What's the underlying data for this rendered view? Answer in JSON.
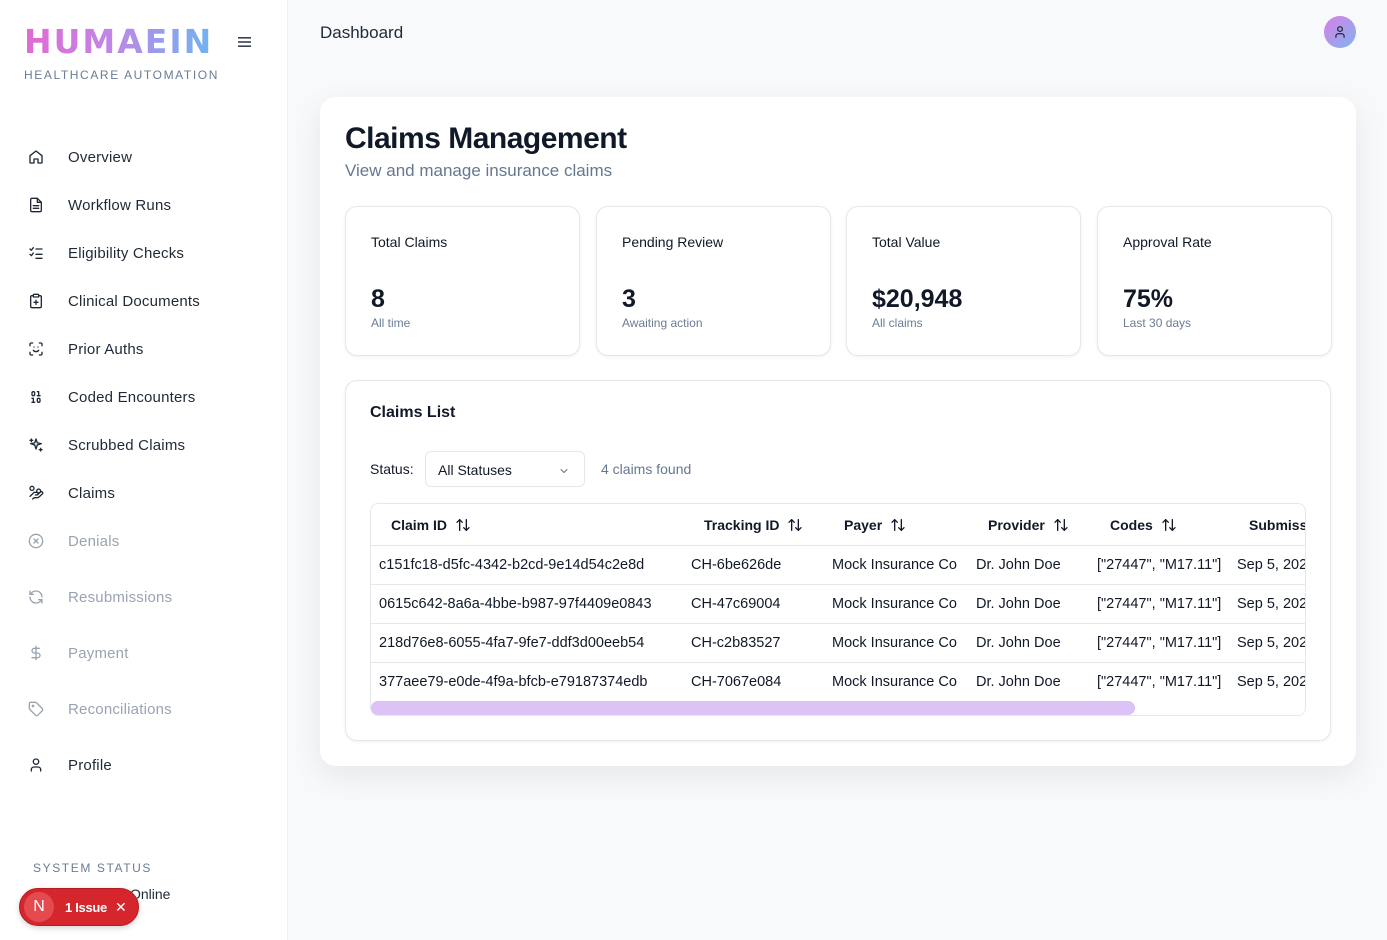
{
  "brand": {
    "name": "HUMAEIN",
    "tagline": "HEALTHCARE AUTOMATION"
  },
  "header": {
    "title": "Dashboard"
  },
  "sidebar": {
    "items": [
      {
        "label": "Overview",
        "icon": "home-icon"
      },
      {
        "label": "Workflow Runs",
        "icon": "file-text-icon"
      },
      {
        "label": "Eligibility Checks",
        "icon": "list-checks-icon"
      },
      {
        "label": "Clinical Documents",
        "icon": "clipboard-icon"
      },
      {
        "label": "Prior Auths",
        "icon": "scan-face-icon"
      },
      {
        "label": "Coded Encounters",
        "icon": "binary-icon"
      },
      {
        "label": "Scrubbed Claims",
        "icon": "sparkles-icon"
      },
      {
        "label": "Claims",
        "icon": "hand-coins-icon"
      },
      {
        "label": "Denials",
        "icon": "circle-x-icon"
      },
      {
        "label": "Resubmissions",
        "icon": "refresh-icon"
      },
      {
        "label": "Payment",
        "icon": "dollar-icon"
      },
      {
        "label": "Reconciliations",
        "icon": "tag-icon"
      },
      {
        "label": "Profile",
        "icon": "user-icon"
      }
    ],
    "system_status_label": "SYSTEM STATUS",
    "system_status_value": "Online",
    "issue_badge": {
      "initial": "N",
      "text": "1 Issue"
    }
  },
  "page": {
    "title": "Claims Management",
    "subtitle": "View and manage insurance claims"
  },
  "stats": [
    {
      "label": "Total Claims",
      "value": "8",
      "note": "All time"
    },
    {
      "label": "Pending Review",
      "value": "3",
      "note": "Awaiting action"
    },
    {
      "label": "Total Value",
      "value": "$20,948",
      "note": "All claims"
    },
    {
      "label": "Approval Rate",
      "value": "75%",
      "note": "Last 30 days"
    }
  ],
  "claims_list": {
    "title": "Claims List",
    "status_label": "Status:",
    "status_selected": "All Statuses",
    "count_text": "4 claims found",
    "columns": [
      "Claim ID",
      "Tracking ID",
      "Payer",
      "Provider",
      "Codes",
      "Submiss"
    ],
    "rows": [
      [
        "c151fc18-d5fc-4342-b2cd-9e14d54c2e8d",
        "CH-6be626de",
        "Mock Insurance Co",
        "Dr. John Doe",
        "[\"27447\", \"M17.11\"]",
        "Sep 5, 202"
      ],
      [
        "0615c642-8a6a-4bbe-b987-97f4409e0843",
        "CH-47c69004",
        "Mock Insurance Co",
        "Dr. John Doe",
        "[\"27447\", \"M17.11\"]",
        "Sep 5, 202"
      ],
      [
        "218d76e8-6055-4fa7-9fe7-ddf3d00eeb54",
        "CH-c2b83527",
        "Mock Insurance Co",
        "Dr. John Doe",
        "[\"27447\", \"M17.11\"]",
        "Sep 5, 202"
      ],
      [
        "377aee79-e0de-4f9a-bfcb-e79187374edb",
        "CH-7067e084",
        "Mock Insurance Co",
        "Dr. John Doe",
        "[\"27447\", \"M17.11\"]",
        "Sep 5, 202"
      ]
    ]
  },
  "colors": {
    "accent_purple": "#dcc2f5",
    "issue_red": "#d5262d",
    "brand_gradient_start": "#e06ad4",
    "brand_gradient_end": "#6fb3f1"
  }
}
